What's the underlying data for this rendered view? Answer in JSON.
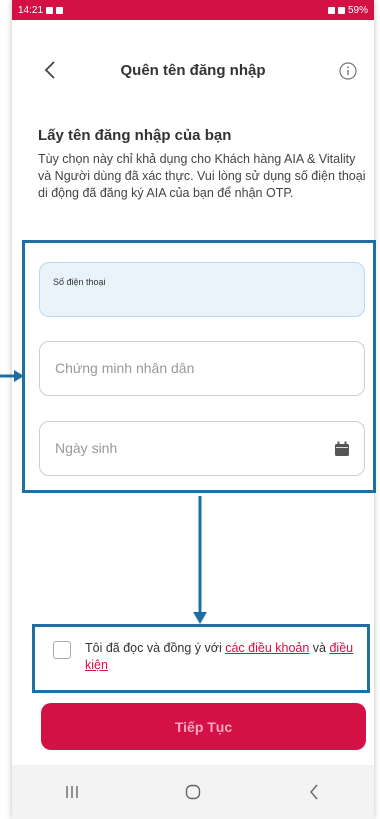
{
  "status_bar": {
    "time": "14:21",
    "battery": "59%"
  },
  "header": {
    "title": "Quên tên đăng nhập"
  },
  "section": {
    "title": "Lấy tên đăng nhập của bạn",
    "description": "Tùy chọn này chỉ khả dụng cho Khách hàng AIA & Vitality và Người dùng đã xác thực. Vui lòng sử dụng số điện thoại di động đã đăng ký AIA của bạn để nhận OTP."
  },
  "form": {
    "phone_label": "Số điện thoại",
    "id_placeholder": "Chứng minh nhân dân",
    "dob_placeholder": "Ngày sinh"
  },
  "terms": {
    "prefix": "Tôi đã đọc và đồng ý với ",
    "link1": "các điều khoản",
    "middle": " và ",
    "link2": "điều kiện"
  },
  "continue_label": "Tiếp Tục",
  "colors": {
    "brand": "#d31145",
    "annotation": "#1f6fa3"
  }
}
